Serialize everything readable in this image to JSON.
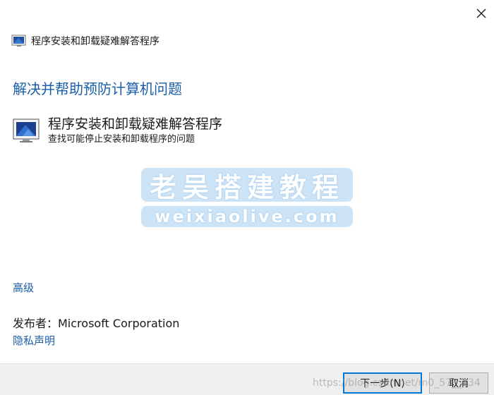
{
  "window": {
    "title": "程序安装和卸载疑难解答程序",
    "close_icon": "close-icon"
  },
  "main": {
    "heading": "解决并帮助预防计算机问题",
    "troubleshooter": {
      "title": "程序安装和卸载疑难解答程序",
      "description": "查找可能停止安装和卸载程序的问题",
      "icon": "troubleshooter-icon"
    },
    "advanced_link": "高级",
    "publisher": "发布者：Microsoft Corporation",
    "privacy_link": "隐私声明"
  },
  "footer": {
    "next_label": "下一步(N)",
    "cancel_label": "取消"
  },
  "watermarks": {
    "line1": "老吴搭建教程",
    "line2": "weixiaolive.com",
    "url": "https://blog.csdn.net/m0_57__134"
  },
  "colors": {
    "link": "#1b5ea8",
    "footer_bg": "#f0f0f0",
    "button_focus_border": "#0078d7"
  }
}
